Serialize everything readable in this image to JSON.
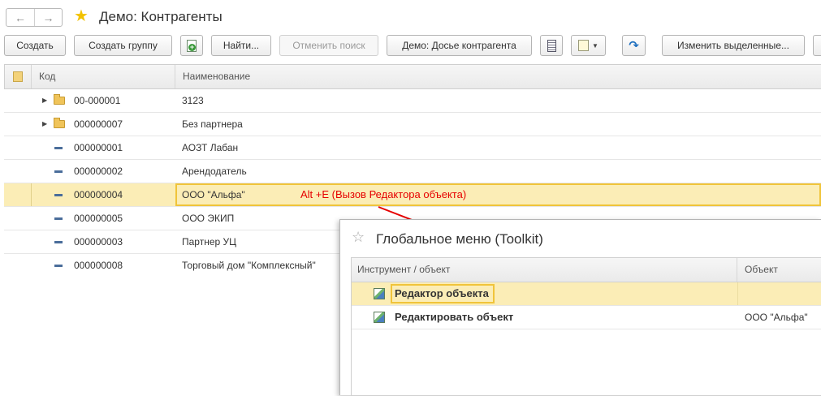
{
  "window": {
    "title": "Демо: Контрагенты",
    "nav": {
      "back_icon": "←",
      "forward_icon": "→"
    }
  },
  "toolbar": {
    "create": "Создать",
    "create_group": "Создать группу",
    "find": "Найти...",
    "cancel_search": "Отменить поиск",
    "dossier": "Демо: Досье контрагента",
    "edit_selected": "Изменить выделенные..."
  },
  "table": {
    "columns": {
      "code": "Код",
      "name": "Наименование"
    },
    "rows": [
      {
        "code": "00-000001",
        "name": "3123",
        "type": "group"
      },
      {
        "code": "000000007",
        "name": "Без партнера",
        "type": "group"
      },
      {
        "code": "000000001",
        "name": "АОЗТ Лабан",
        "type": "item"
      },
      {
        "code": "000000002",
        "name": "Арендодатель",
        "type": "item"
      },
      {
        "code": "000000004",
        "name": "ООО \"Альфа\"",
        "type": "item",
        "selected": true
      },
      {
        "code": "000000005",
        "name": "ООО ЭКИП",
        "type": "item"
      },
      {
        "code": "000000003",
        "name": "Партнер УЦ",
        "type": "item"
      },
      {
        "code": "000000008",
        "name": "Торговый дом \"Комплексный\"",
        "type": "item"
      }
    ]
  },
  "annotation": {
    "text": "Alt +E (Вызов Редактора объекта)",
    "color": "#e60000"
  },
  "panel": {
    "title": "Глобальное меню (Toolkit)",
    "columns": {
      "tool": "Инструмент / объект",
      "object": "Объект"
    },
    "rows": [
      {
        "tool": "Редактор объекта",
        "object": "",
        "selected": true
      },
      {
        "tool": "Редактировать объект",
        "object": "ООО \"Альфа\""
      }
    ]
  },
  "colors": {
    "selection": "#fbedb6",
    "selection_border": "#f0c43a",
    "star": "#f2c200"
  }
}
